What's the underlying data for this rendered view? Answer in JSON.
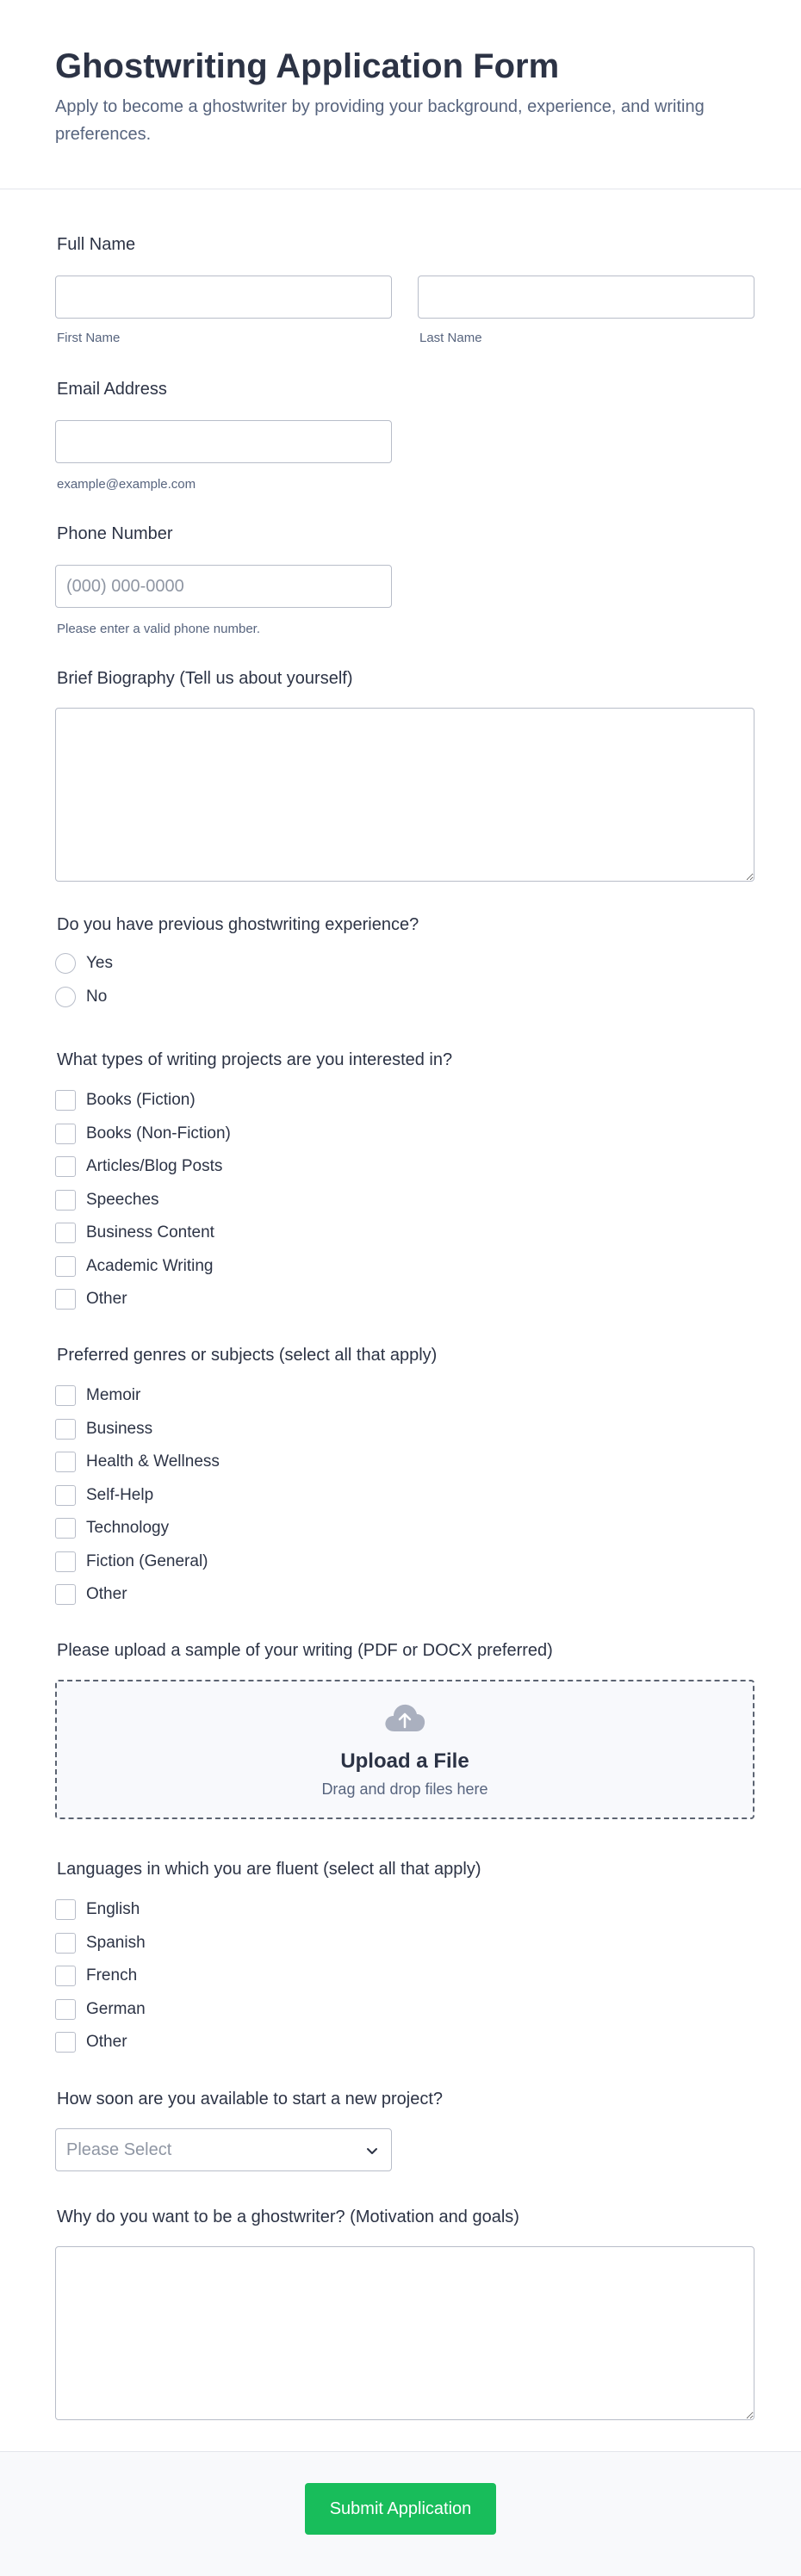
{
  "header": {
    "title": "Ghostwriting Application Form",
    "subtitle": "Apply to become a ghostwriter by providing your background, experience, and writing preferences."
  },
  "full_name": {
    "label": "Full Name",
    "first_sublabel": "First Name",
    "last_sublabel": "Last Name",
    "first_value": "",
    "last_value": ""
  },
  "email": {
    "label": "Email Address",
    "value": "",
    "sublabel": "example@example.com"
  },
  "phone": {
    "label": "Phone Number",
    "placeholder": "(000) 000-0000",
    "sublabel": "Please enter a valid phone number."
  },
  "bio": {
    "label": "Brief Biography (Tell us about yourself)",
    "value": ""
  },
  "experience": {
    "label": "Do you have previous ghostwriting experience?",
    "options": [
      "Yes",
      "No"
    ]
  },
  "project_types": {
    "label": "What types of writing projects are you interested in?",
    "options": [
      "Books (Fiction)",
      "Books (Non-Fiction)",
      "Articles/Blog Posts",
      "Speeches",
      "Business Content",
      "Academic Writing",
      "Other"
    ]
  },
  "genres": {
    "label": "Preferred genres or subjects (select all that apply)",
    "options": [
      "Memoir",
      "Business",
      "Health & Wellness",
      "Self-Help",
      "Technology",
      "Fiction (General)",
      "Other"
    ]
  },
  "upload": {
    "label": "Please upload a sample of your writing (PDF or DOCX preferred)",
    "title": "Upload a File",
    "subtitle": "Drag and drop files here",
    "icon": "cloud-upload-icon"
  },
  "languages": {
    "label": "Languages in which you are fluent (select all that apply)",
    "options": [
      "English",
      "Spanish",
      "French",
      "German",
      "Other"
    ]
  },
  "availability": {
    "label": "How soon are you available to start a new project?",
    "selected": "Please Select"
  },
  "motivation": {
    "label": "Why do you want to be a ghostwriter? (Motivation and goals)",
    "value": ""
  },
  "footer": {
    "submit_label": "Submit Application"
  },
  "colors": {
    "accent": "#18bd5b",
    "text": "#2c3345",
    "muted": "#57647e",
    "border": "#b8bdc9"
  }
}
